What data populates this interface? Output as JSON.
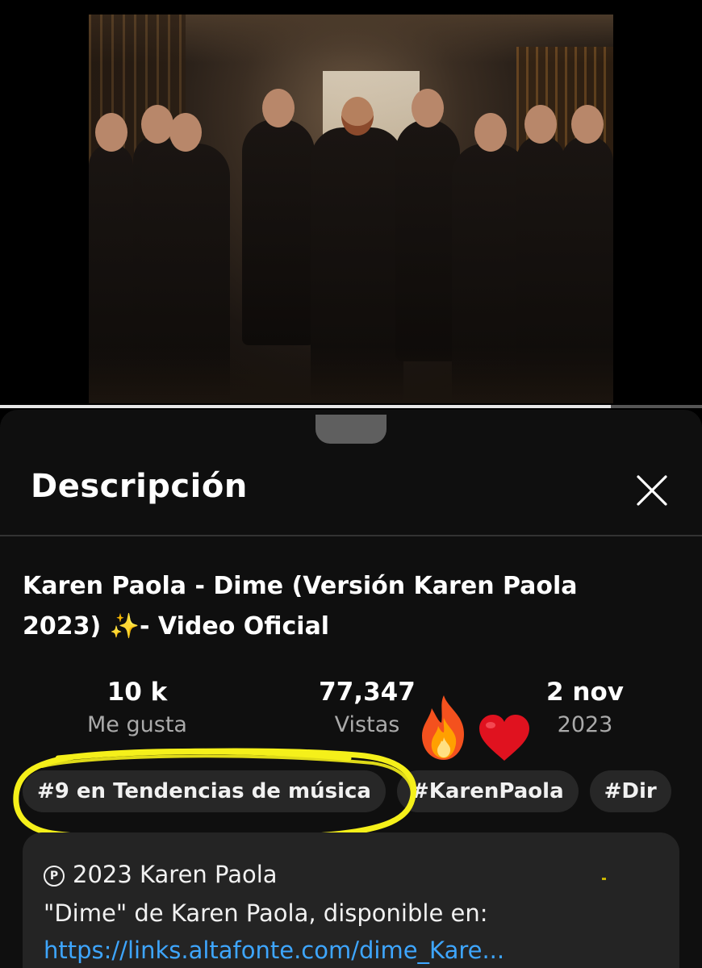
{
  "video": {
    "progress": 0.87
  },
  "sheet": {
    "title": "Descripción",
    "close_icon": "close-icon"
  },
  "video_info": {
    "title_line1": "Karen Paola - Dime (Versión Karen Paola",
    "title_line2_start": "2023) ",
    "title_emoji": "✨",
    "title_line2_end": "- Video Oficial"
  },
  "stats": {
    "likes_value": "10 k",
    "likes_label": "Me gusta",
    "views_value": "77,347",
    "views_label": "Vistas",
    "date_value": "2 nov",
    "date_label": "2023"
  },
  "chips": [
    "#9 en Tendencias de música",
    "#KarenPaola",
    "#Dir"
  ],
  "description": {
    "copyright_symbol": "P",
    "line1": "2023 Karen Paola",
    "line2": "\"Dime\" de Karen Paola, disponible en:",
    "link": "https://links.altafonte.com/dime_Kare..."
  },
  "colors": {
    "highlight": "#f5f01a",
    "link": "#3ea6ff",
    "chip_bg": "#272727",
    "sheet_bg": "#0f0f0f"
  }
}
